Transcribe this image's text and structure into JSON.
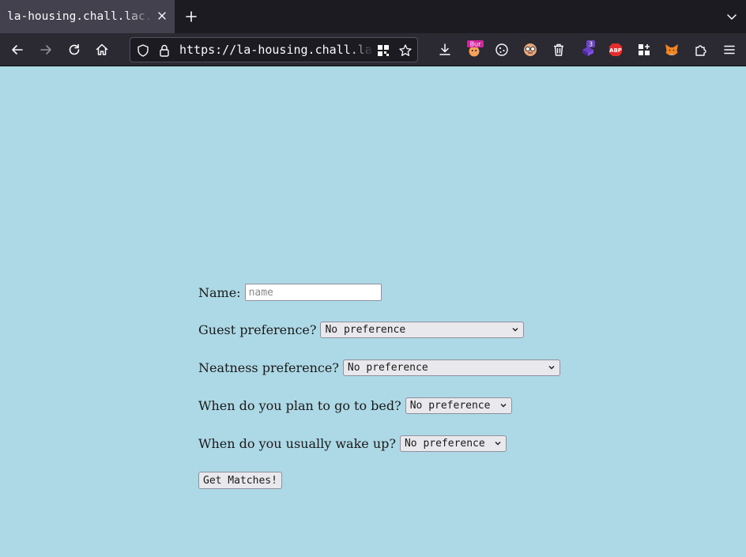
{
  "browser": {
    "tab_title": "la-housing.chall.lac.tf",
    "url": "https://la-housing.chall.lac.tf",
    "extensions": {
      "bur_badge": "Bur",
      "counter_badge": "3",
      "abp_label": "ABP"
    }
  },
  "form": {
    "name_label": "Name:",
    "name_placeholder": "name",
    "guest_label": "Guest preference?",
    "guest_value": "No preference",
    "neatness_label": "Neatness preference?",
    "neatness_value": "No preference",
    "bed_label": "When do you plan to go to bed?",
    "bed_value": "No preference",
    "wake_label": "When do you usually wake up?",
    "wake_value": "No preference",
    "submit_label": "Get Matches!"
  },
  "colors": {
    "page_background": "#add8e6",
    "toolbar": "#2b2a33",
    "tabstrip": "#1c1b22"
  }
}
